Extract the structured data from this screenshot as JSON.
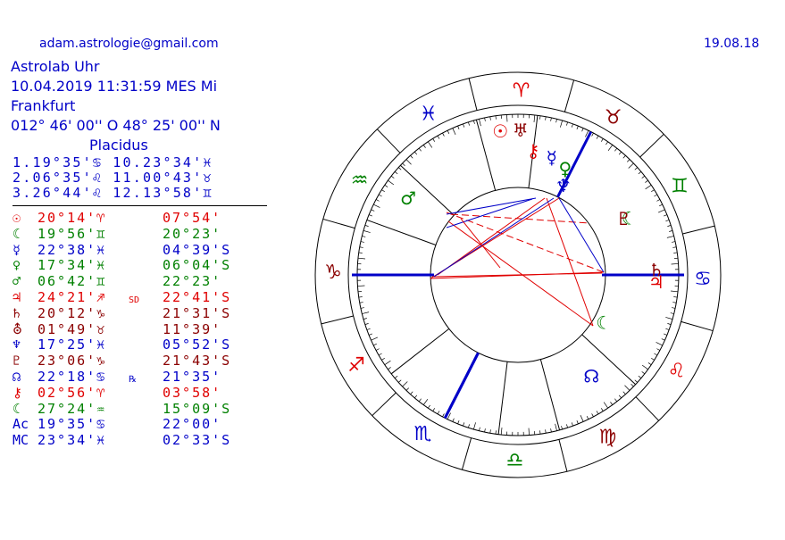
{
  "header": {
    "email": "adam.astrologie@gmail.com",
    "date_right": "19.08.18",
    "title": "Astrolab Uhr",
    "datetime": "10.04.2019  11:31:59  MES Mi",
    "place": "Frankfurt",
    "coords": "012° 46' 00'' O   48° 25' 00'' N",
    "system": "Placidus"
  },
  "houses": [
    "1.19°35'♋ 10.23°34'♓",
    "2.06°35'♌ 11.00°43'♉",
    "3.26°44'♌ 12.13°58'♊"
  ],
  "planets": [
    {
      "glyph": "☉",
      "pos": "20°14'♈",
      "decl": "07°54'",
      "color": "#e00000"
    },
    {
      "glyph": "☾",
      "pos": "19°56'♊",
      "decl": "20°23'",
      "color": "#008000"
    },
    {
      "glyph": "☿",
      "pos": "22°38'♓",
      "decl": "04°39'S",
      "color": "#0000c8"
    },
    {
      "glyph": "♀",
      "pos": "17°34'♓",
      "decl": "06°04'S",
      "color": "#008000"
    },
    {
      "glyph": "♂",
      "pos": "06°42'♊",
      "decl": "22°23'",
      "color": "#008000"
    },
    {
      "glyph": "♃",
      "pos": "24°21'♐",
      "flag": "SD",
      "decl": "22°41'S",
      "color": "#e00000"
    },
    {
      "glyph": "♄",
      "pos": "20°12'♑",
      "decl": "21°31'S",
      "color": "#8b0000"
    },
    {
      "glyph": "⛢",
      "pos": "01°49'♉",
      "decl": "11°39'",
      "color": "#8b0000"
    },
    {
      "glyph": "♆",
      "pos": "17°25'♓",
      "decl": "05°52'S",
      "color": "#0000c8"
    },
    {
      "glyph": "♇",
      "pos": "23°06'♑",
      "decl": "21°43'S",
      "color": "#8b0000"
    },
    {
      "glyph": "☊",
      "pos": "22°18'♋",
      "flag": "℞",
      "decl": "21°35'",
      "color": "#0000c8"
    },
    {
      "glyph": "⚷",
      "pos": "02°56'♈",
      "decl": "03°58'",
      "color": "#e00000"
    },
    {
      "glyph": "☾",
      "pos": "27°24'♒",
      "decl": "15°09'S",
      "color": "#008000"
    },
    {
      "glyph": "Ac",
      "pos": "19°35'♋",
      "decl": "22°00'",
      "color": "#0000c8"
    },
    {
      "glyph": "MC",
      "pos": "23°34'♓",
      "decl": "02°33'S",
      "color": "#0000c8"
    }
  ],
  "wheel": {
    "signs": [
      {
        "glyph": "♈",
        "color": "#e00000"
      },
      {
        "glyph": "♉",
        "color": "#8b0000"
      },
      {
        "glyph": "♊",
        "color": "#008000"
      },
      {
        "glyph": "♋",
        "color": "#0000c8"
      },
      {
        "glyph": "♌",
        "color": "#e00000"
      },
      {
        "glyph": "♍",
        "color": "#8b0000"
      },
      {
        "glyph": "♎",
        "color": "#008000"
      },
      {
        "glyph": "♏",
        "color": "#0000c8"
      },
      {
        "glyph": "♐",
        "color": "#e00000"
      },
      {
        "glyph": "♑",
        "color": "#8b0000"
      },
      {
        "glyph": "♒",
        "color": "#008000"
      },
      {
        "glyph": "♓",
        "color": "#0000c8"
      }
    ],
    "chart_planets": [
      {
        "glyph": "☉",
        "color": "#e00000"
      },
      {
        "glyph": "♅",
        "color": "#8b0000"
      },
      {
        "glyph": "⚷",
        "color": "#e00000"
      },
      {
        "glyph": "☿",
        "color": "#0000c8"
      },
      {
        "glyph": "♀",
        "color": "#008000"
      },
      {
        "glyph": "♆",
        "color": "#0000c8"
      },
      {
        "glyph": "☾",
        "color": "#008000"
      },
      {
        "glyph": "♇",
        "color": "#8b0000"
      },
      {
        "glyph": "♄",
        "color": "#8b0000"
      },
      {
        "glyph": "♃",
        "color": "#e00000"
      },
      {
        "glyph": "☊",
        "color": "#0000c8"
      },
      {
        "glyph": "☾",
        "color": "#008000"
      },
      {
        "glyph": "♂",
        "color": "#008000"
      }
    ],
    "aspect_colors": {
      "hard": "#e00000",
      "soft": "#0000c8"
    }
  }
}
